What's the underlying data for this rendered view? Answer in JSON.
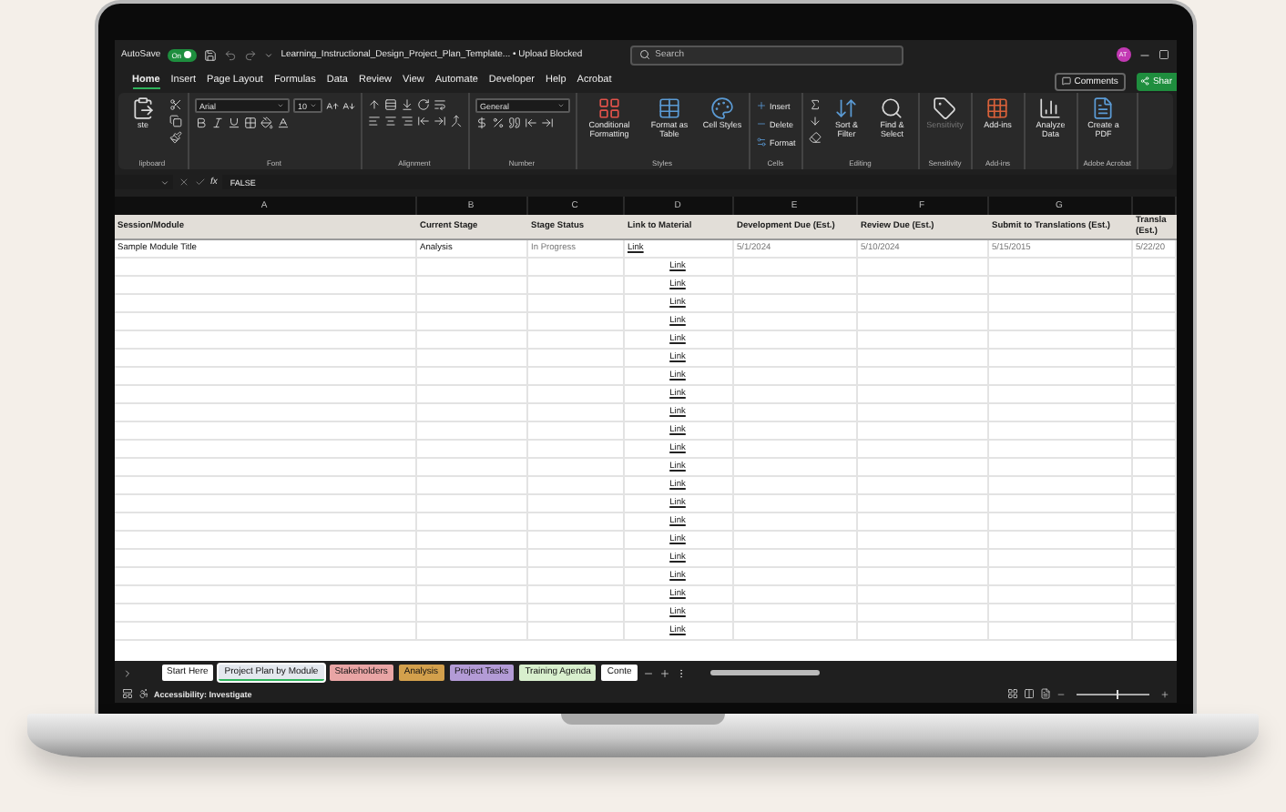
{
  "title_bar": {
    "autosave_label": "AutoSave",
    "autosave": {
      "label": "On",
      "on": true
    },
    "document_title": "Learning_Instructional_Design_Project_Plan_Template... • Upload Blocked",
    "search": {
      "placeholder": "Search"
    },
    "avatar": "AT"
  },
  "menu": [
    {
      "label": "Home",
      "selected": true
    },
    {
      "label": "Insert",
      "selected": false
    },
    {
      "label": "Page Layout",
      "selected": false
    },
    {
      "label": "Formulas",
      "selected": false
    },
    {
      "label": "Data",
      "selected": false
    },
    {
      "label": "Review",
      "selected": false
    },
    {
      "label": "View",
      "selected": false
    },
    {
      "label": "Automate",
      "selected": false
    },
    {
      "label": "Developer",
      "selected": false
    },
    {
      "label": "Help",
      "selected": false
    },
    {
      "label": "Acrobat",
      "selected": false
    }
  ],
  "comments_button": "Comments",
  "share_button": "Shar",
  "ribbon": {
    "groups": [
      {
        "label": "lipboard",
        "items": [
          {
            "kind": "large",
            "label": "ste",
            "disabled": false
          },
          {
            "kind": "rows",
            "rows": [
              [
                {
                  "kind": "icon"
                }
              ],
              [
                {
                  "kind": "icon"
                }
              ],
              [
                {
                  "kind": "icon"
                }
              ]
            ]
          }
        ]
      },
      {
        "label": "Font",
        "items": [
          {
            "kind": "rows",
            "rows": [
              [
                {
                  "kind": "field",
                  "value": "Arial"
                },
                {
                  "kind": "field",
                  "value": "10"
                },
                {
                  "kind": "icon"
                },
                {
                  "kind": "icon"
                }
              ],
              [
                {
                  "kind": "icon"
                },
                {
                  "kind": "icon"
                },
                {
                  "kind": "icon"
                },
                {
                  "kind": "icon"
                },
                {
                  "kind": "icon"
                },
                {
                  "kind": "icon"
                }
              ]
            ]
          }
        ]
      },
      {
        "label": "Alignment",
        "items": [
          {
            "kind": "rows",
            "rows": [
              [
                {
                  "kind": "icon"
                },
                {
                  "kind": "icon"
                },
                {
                  "kind": "icon"
                },
                {
                  "kind": "icon"
                },
                {
                  "kind": "icon"
                }
              ],
              [
                {
                  "kind": "icon"
                },
                {
                  "kind": "icon"
                },
                {
                  "kind": "icon"
                },
                {
                  "kind": "icon"
                },
                {
                  "kind": "icon"
                },
                {
                  "kind": "icon"
                }
              ]
            ]
          }
        ]
      },
      {
        "label": "Number",
        "items": [
          {
            "kind": "rows",
            "rows": [
              [
                {
                  "kind": "field",
                  "value": "General"
                }
              ],
              [
                {
                  "kind": "icon"
                },
                {
                  "kind": "icon"
                },
                {
                  "kind": "icon"
                },
                {
                  "kind": "icon"
                },
                {
                  "kind": "icon"
                }
              ]
            ]
          }
        ]
      },
      {
        "label": "Styles",
        "items": [
          {
            "kind": "large",
            "label": "Conditional Formatting",
            "disabled": false
          },
          {
            "kind": "large",
            "label": "Format as Table",
            "disabled": false
          },
          {
            "kind": "large",
            "label": "Cell Styles",
            "disabled": false
          }
        ]
      },
      {
        "label": "Cells",
        "items": [
          {
            "kind": "rows",
            "rows": [
              [
                {
                  "kind": "small",
                  "label": "Insert"
                }
              ],
              [
                {
                  "kind": "small",
                  "label": "Delete"
                }
              ],
              [
                {
                  "kind": "small",
                  "label": "Format"
                }
              ]
            ]
          }
        ]
      },
      {
        "label": "Editing",
        "items": [
          {
            "kind": "rows",
            "rows": [
              [
                {
                  "kind": "icon"
                }
              ],
              [
                {
                  "kind": "icon"
                }
              ],
              [
                {
                  "kind": "icon"
                }
              ]
            ]
          },
          {
            "kind": "large",
            "label": "Sort & Filter",
            "disabled": false
          },
          {
            "kind": "large",
            "label": "Find & Select",
            "disabled": false
          }
        ]
      },
      {
        "label": "Sensitivity",
        "items": [
          {
            "kind": "large",
            "label": "Sensitivity",
            "disabled": true
          }
        ]
      },
      {
        "label": "Add-ins",
        "items": [
          {
            "kind": "large",
            "label": "Add-ins",
            "disabled": false
          }
        ]
      },
      {
        "items": [
          {
            "kind": "large",
            "label": "Analyze Data",
            "disabled": false
          }
        ]
      },
      {
        "label": "Adobe Acrobat",
        "items": [
          {
            "kind": "large",
            "label": "Create a PDF",
            "disabled": false
          }
        ]
      }
    ]
  },
  "formula_bar": {
    "function_label": "fx",
    "value": "FALSE"
  },
  "columns": [
    {
      "letter": "A",
      "header": "Session/Module"
    },
    {
      "letter": "B",
      "header": "Current Stage"
    },
    {
      "letter": "C",
      "header": "Stage Status"
    },
    {
      "letter": "D",
      "header": "Link to Material"
    },
    {
      "letter": "E",
      "header": "Development Due (Est.)"
    },
    {
      "letter": "F",
      "header": "Review Due (Est.)"
    },
    {
      "letter": "G",
      "header": "Submit to Translations (Est.)"
    },
    {
      "header": "Transla (Est.)"
    }
  ],
  "rows": [
    {
      "A": "Sample Module Title",
      "B": "Analysis",
      "C": "In Progress",
      "D": "Link",
      "E": "5/1/2024",
      "F": "5/10/2024",
      "G": "5/15/2015",
      "H": "5/22/20"
    },
    {
      "D": "Link"
    },
    {
      "D": "Link"
    },
    {
      "D": "Link"
    },
    {
      "D": "Link"
    },
    {
      "D": "Link"
    },
    {
      "D": "Link"
    },
    {
      "D": "Link"
    },
    {
      "D": "Link"
    },
    {
      "D": "Link"
    },
    {
      "D": "Link"
    },
    {
      "D": "Link"
    },
    {
      "D": "Link"
    },
    {
      "D": "Link"
    },
    {
      "D": "Link"
    },
    {
      "D": "Link"
    },
    {
      "D": "Link"
    },
    {
      "D": "Link"
    },
    {
      "D": "Link"
    },
    {
      "D": "Link"
    },
    {
      "D": "Link"
    },
    {
      "D": "Link"
    }
  ],
  "sheet_tabs": [
    {
      "label": "Start Here",
      "selected": false,
      "color": "#ffffff"
    },
    {
      "label": "Project Plan by Module",
      "selected": true,
      "color": "#e4e8ee"
    },
    {
      "label": "Stakeholders",
      "selected": false,
      "color": "#e9a5a5"
    },
    {
      "label": "Analysis",
      "selected": false,
      "color": "#d3a04c"
    },
    {
      "label": "Project Tasks",
      "selected": false,
      "color": "#b39bd6"
    },
    {
      "label": "Training Agenda",
      "selected": false,
      "color": "#d8efcd"
    },
    {
      "label": "Conte",
      "selected": false,
      "color": "#ffffff"
    }
  ],
  "status_bar": {
    "accessibility": "Accessibility: Investigate",
    "zoom_slider": {
      "level": 0.55
    }
  }
}
